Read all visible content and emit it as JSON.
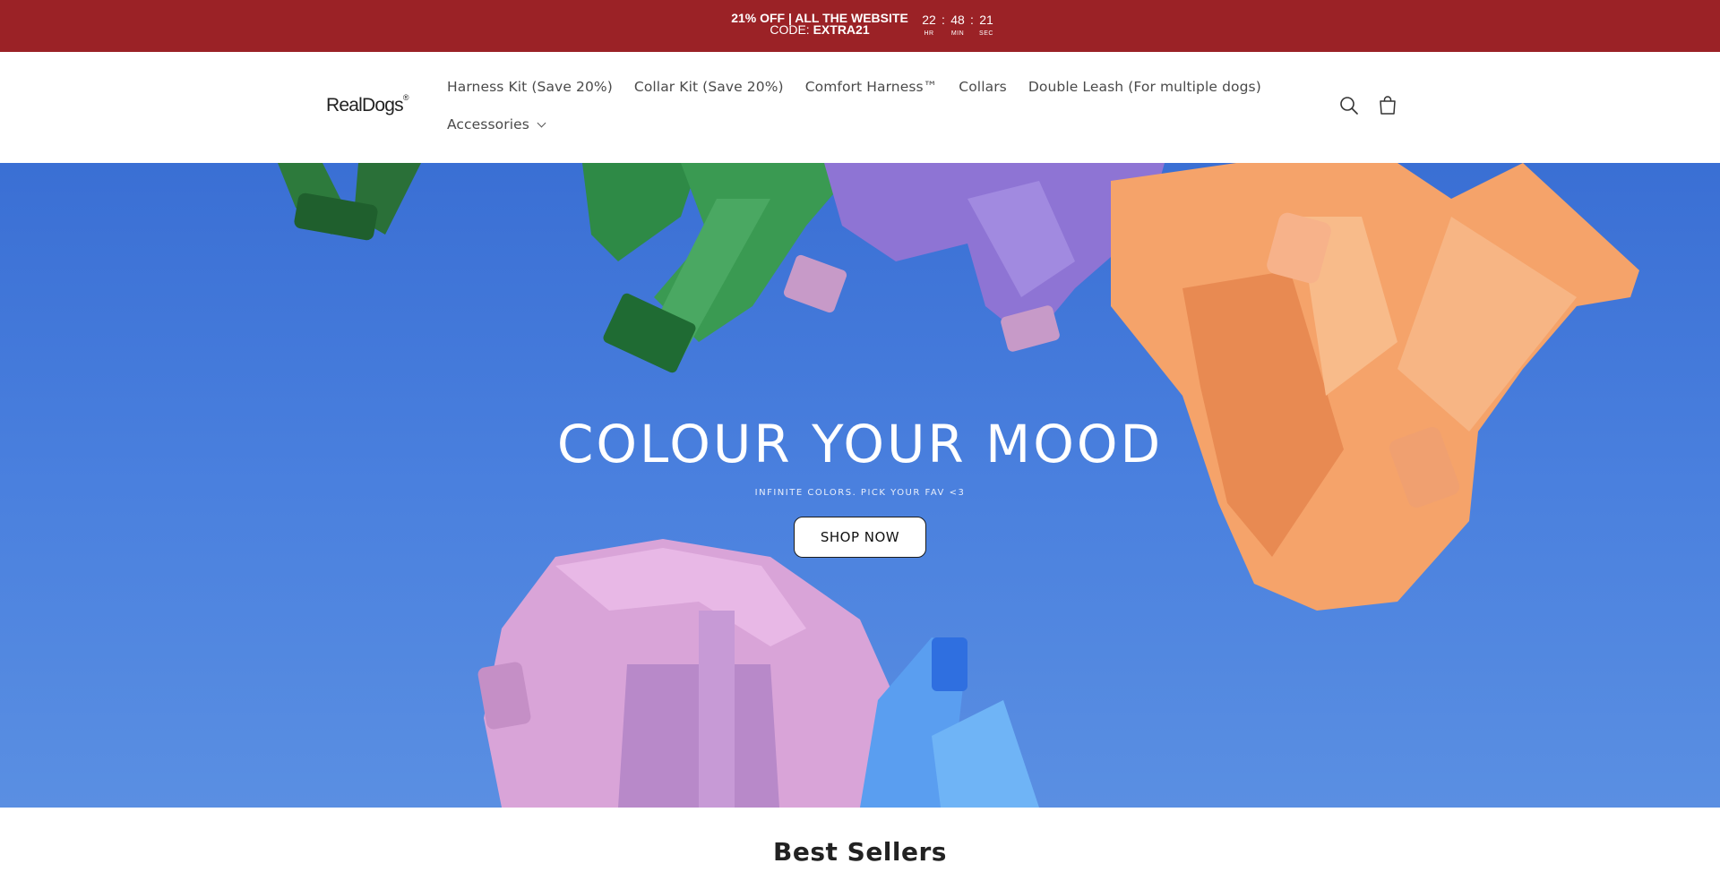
{
  "announcement": {
    "line1": "21% OFF | ALL THE WEBSITE",
    "code_prefix": "CODE:",
    "code": "EXTRA21",
    "timer": {
      "hours": "22",
      "minutes": "48",
      "seconds": "21",
      "hours_label": "HR",
      "minutes_label": "MIN",
      "seconds_label": "SEC",
      "separator": ":"
    },
    "bg_color": "#9b2226"
  },
  "header": {
    "logo_text": "RealDogs",
    "logo_mark": "®",
    "nav": [
      {
        "label": "Harness Kit (Save 20%)"
      },
      {
        "label": "Collar Kit (Save 20%)"
      },
      {
        "label": "Comfort Harness™"
      },
      {
        "label": "Collars"
      },
      {
        "label": "Double Leash (For multiple dogs)"
      },
      {
        "label": "Accessories"
      }
    ],
    "icons": [
      "search-icon",
      "cart-icon"
    ]
  },
  "hero": {
    "title": "COLOUR YOUR MOOD",
    "subtitle": "INFINITE COLORS. PICK YOUR FAV <3",
    "cta_label": "SHOP NOW",
    "bg_color": "#4a80de"
  },
  "best_sellers": {
    "title": "Best Sellers"
  }
}
